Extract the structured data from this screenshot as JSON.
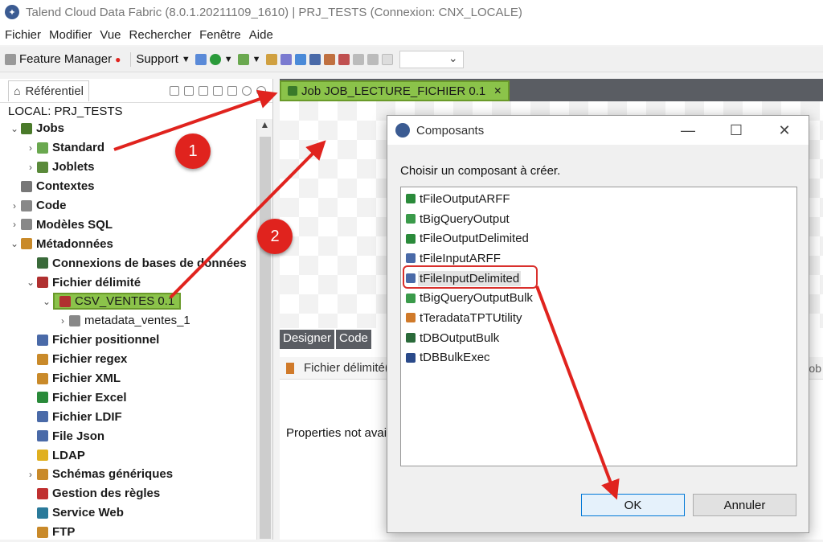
{
  "window": {
    "title": "Talend Cloud Data Fabric (8.0.1.20211109_1610) | PRJ_TESTS (Connexion: CNX_LOCALE)"
  },
  "menu": [
    "Fichier",
    "Modifier",
    "Vue",
    "Rechercher",
    "Fenêtre",
    "Aide"
  ],
  "toolbar": {
    "feature_manager": "Feature Manager",
    "support": "Support"
  },
  "repository": {
    "tab_label": "Référentiel",
    "project": "LOCAL: PRJ_TESTS",
    "tree": [
      {
        "label": "Jobs",
        "level": 0,
        "twisty": "open",
        "bold": true,
        "icon": "jobs-icon",
        "color": "#4a7a2a"
      },
      {
        "label": "Standard",
        "level": 1,
        "twisty": "closed",
        "bold": true,
        "icon": "folder-icon",
        "color": "#6aa84f"
      },
      {
        "label": "Joblets",
        "level": 1,
        "twisty": "closed",
        "bold": true,
        "icon": "joblet-icon",
        "color": "#5a8a3a"
      },
      {
        "label": "Contextes",
        "level": 0,
        "twisty": "none",
        "bold": true,
        "icon": "context-icon",
        "color": "#777777"
      },
      {
        "label": "Code",
        "level": 0,
        "twisty": "closed",
        "bold": true,
        "icon": "code-icon",
        "color": "#888888"
      },
      {
        "label": "Modèles SQL",
        "level": 0,
        "twisty": "closed",
        "bold": true,
        "icon": "sql-icon",
        "color": "#888888"
      },
      {
        "label": "Métadonnées",
        "level": 0,
        "twisty": "open",
        "bold": true,
        "icon": "metadata-icon",
        "color": "#c98a2a"
      },
      {
        "label": "Connexions de bases de données",
        "level": 1,
        "twisty": "none",
        "bold": true,
        "icon": "db-icon",
        "color": "#3a6a3a"
      },
      {
        "label": "Fichier délimité",
        "level": 1,
        "twisty": "open",
        "bold": true,
        "icon": "file-delimited-icon",
        "color": "#b03030"
      },
      {
        "label": "CSV_VENTES 0.1",
        "level": 2,
        "twisty": "open",
        "bold": false,
        "icon": "file-delimited-icon",
        "color": "#b03030",
        "highlight": true
      },
      {
        "label": "metadata_ventes_1",
        "level": 3,
        "twisty": "closed",
        "bold": false,
        "icon": "table-icon",
        "color": "#888888"
      },
      {
        "label": "Fichier positionnel",
        "level": 1,
        "twisty": "none",
        "bold": true,
        "icon": "file-positional-icon",
        "color": "#4a6aa8"
      },
      {
        "label": "Fichier regex",
        "level": 1,
        "twisty": "none",
        "bold": true,
        "icon": "file-regex-icon",
        "color": "#c98a2a"
      },
      {
        "label": "Fichier XML",
        "level": 1,
        "twisty": "none",
        "bold": true,
        "icon": "file-xml-icon",
        "color": "#c98a2a"
      },
      {
        "label": "Fichier Excel",
        "level": 1,
        "twisty": "none",
        "bold": true,
        "icon": "file-excel-icon",
        "color": "#2a8a3a"
      },
      {
        "label": "Fichier LDIF",
        "level": 1,
        "twisty": "none",
        "bold": true,
        "icon": "file-ldif-icon",
        "color": "#4a6aa8"
      },
      {
        "label": "File Json",
        "level": 1,
        "twisty": "none",
        "bold": true,
        "icon": "file-json-icon",
        "color": "#4a6aa8"
      },
      {
        "label": "LDAP",
        "level": 1,
        "twisty": "none",
        "bold": true,
        "icon": "ldap-icon",
        "color": "#e0b020"
      },
      {
        "label": "Schémas génériques",
        "level": 1,
        "twisty": "closed",
        "bold": true,
        "icon": "schema-icon",
        "color": "#c98a2a"
      },
      {
        "label": "Gestion des règles",
        "level": 1,
        "twisty": "none",
        "bold": true,
        "icon": "rules-icon",
        "color": "#c03030"
      },
      {
        "label": "Service Web",
        "level": 1,
        "twisty": "none",
        "bold": true,
        "icon": "webservice-icon",
        "color": "#2a7a9a"
      },
      {
        "label": "FTP",
        "level": 1,
        "twisty": "none",
        "bold": true,
        "icon": "ftp-icon",
        "color": "#c98a2a"
      }
    ]
  },
  "editor": {
    "tab_label": "Job JOB_LECTURE_FICHIER 0.1",
    "designer_tab": "Designer",
    "code_tab": "Code",
    "properties_title": "Fichier délimité(",
    "properties_right": "Job",
    "properties_message": "Properties not avai"
  },
  "dialog": {
    "title": "Composants",
    "prompt": "Choisir un composant à créer.",
    "components": [
      {
        "label": "tFileOutputARFF",
        "color": "#2a8a3a"
      },
      {
        "label": "tBigQueryOutput",
        "color": "#3a9a4a"
      },
      {
        "label": "tFileOutputDelimited",
        "color": "#2a8a3a"
      },
      {
        "label": "tFileInputARFF",
        "color": "#4a6aa8"
      },
      {
        "label": "tFileInputDelimited",
        "color": "#4a6aa8",
        "selected": true
      },
      {
        "label": "tBigQueryOutputBulk",
        "color": "#3a9a4a"
      },
      {
        "label": "tTeradataTPTUtility",
        "color": "#d07a2a"
      },
      {
        "label": "tDBOutputBulk",
        "color": "#2a6a3a"
      },
      {
        "label": "tDBBulkExec",
        "color": "#2a4a8a"
      }
    ],
    "ok": "OK",
    "cancel": "Annuler"
  },
  "annotations": {
    "badge1": "1",
    "badge2": "2",
    "color": "#e0231e"
  }
}
